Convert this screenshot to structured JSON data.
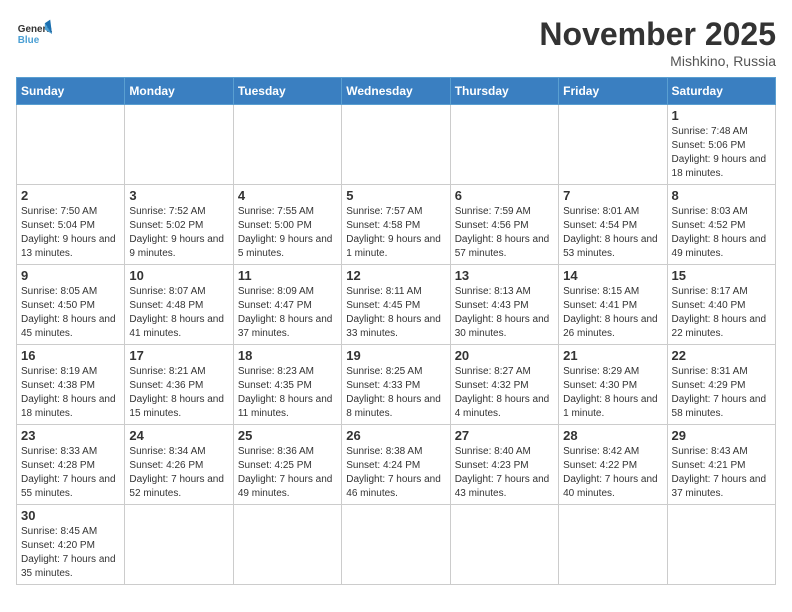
{
  "header": {
    "logo_general": "General",
    "logo_blue": "Blue",
    "month_title": "November 2025",
    "location": "Mishkino, Russia"
  },
  "weekdays": [
    "Sunday",
    "Monday",
    "Tuesday",
    "Wednesday",
    "Thursday",
    "Friday",
    "Saturday"
  ],
  "weeks": [
    [
      {
        "day": "",
        "info": ""
      },
      {
        "day": "",
        "info": ""
      },
      {
        "day": "",
        "info": ""
      },
      {
        "day": "",
        "info": ""
      },
      {
        "day": "",
        "info": ""
      },
      {
        "day": "",
        "info": ""
      },
      {
        "day": "1",
        "info": "Sunrise: 7:48 AM\nSunset: 5:06 PM\nDaylight: 9 hours and 18 minutes."
      }
    ],
    [
      {
        "day": "2",
        "info": "Sunrise: 7:50 AM\nSunset: 5:04 PM\nDaylight: 9 hours and 13 minutes."
      },
      {
        "day": "3",
        "info": "Sunrise: 7:52 AM\nSunset: 5:02 PM\nDaylight: 9 hours and 9 minutes."
      },
      {
        "day": "4",
        "info": "Sunrise: 7:55 AM\nSunset: 5:00 PM\nDaylight: 9 hours and 5 minutes."
      },
      {
        "day": "5",
        "info": "Sunrise: 7:57 AM\nSunset: 4:58 PM\nDaylight: 9 hours and 1 minute."
      },
      {
        "day": "6",
        "info": "Sunrise: 7:59 AM\nSunset: 4:56 PM\nDaylight: 8 hours and 57 minutes."
      },
      {
        "day": "7",
        "info": "Sunrise: 8:01 AM\nSunset: 4:54 PM\nDaylight: 8 hours and 53 minutes."
      },
      {
        "day": "8",
        "info": "Sunrise: 8:03 AM\nSunset: 4:52 PM\nDaylight: 8 hours and 49 minutes."
      }
    ],
    [
      {
        "day": "9",
        "info": "Sunrise: 8:05 AM\nSunset: 4:50 PM\nDaylight: 8 hours and 45 minutes."
      },
      {
        "day": "10",
        "info": "Sunrise: 8:07 AM\nSunset: 4:48 PM\nDaylight: 8 hours and 41 minutes."
      },
      {
        "day": "11",
        "info": "Sunrise: 8:09 AM\nSunset: 4:47 PM\nDaylight: 8 hours and 37 minutes."
      },
      {
        "day": "12",
        "info": "Sunrise: 8:11 AM\nSunset: 4:45 PM\nDaylight: 8 hours and 33 minutes."
      },
      {
        "day": "13",
        "info": "Sunrise: 8:13 AM\nSunset: 4:43 PM\nDaylight: 8 hours and 30 minutes."
      },
      {
        "day": "14",
        "info": "Sunrise: 8:15 AM\nSunset: 4:41 PM\nDaylight: 8 hours and 26 minutes."
      },
      {
        "day": "15",
        "info": "Sunrise: 8:17 AM\nSunset: 4:40 PM\nDaylight: 8 hours and 22 minutes."
      }
    ],
    [
      {
        "day": "16",
        "info": "Sunrise: 8:19 AM\nSunset: 4:38 PM\nDaylight: 8 hours and 18 minutes."
      },
      {
        "day": "17",
        "info": "Sunrise: 8:21 AM\nSunset: 4:36 PM\nDaylight: 8 hours and 15 minutes."
      },
      {
        "day": "18",
        "info": "Sunrise: 8:23 AM\nSunset: 4:35 PM\nDaylight: 8 hours and 11 minutes."
      },
      {
        "day": "19",
        "info": "Sunrise: 8:25 AM\nSunset: 4:33 PM\nDaylight: 8 hours and 8 minutes."
      },
      {
        "day": "20",
        "info": "Sunrise: 8:27 AM\nSunset: 4:32 PM\nDaylight: 8 hours and 4 minutes."
      },
      {
        "day": "21",
        "info": "Sunrise: 8:29 AM\nSunset: 4:30 PM\nDaylight: 8 hours and 1 minute."
      },
      {
        "day": "22",
        "info": "Sunrise: 8:31 AM\nSunset: 4:29 PM\nDaylight: 7 hours and 58 minutes."
      }
    ],
    [
      {
        "day": "23",
        "info": "Sunrise: 8:33 AM\nSunset: 4:28 PM\nDaylight: 7 hours and 55 minutes."
      },
      {
        "day": "24",
        "info": "Sunrise: 8:34 AM\nSunset: 4:26 PM\nDaylight: 7 hours and 52 minutes."
      },
      {
        "day": "25",
        "info": "Sunrise: 8:36 AM\nSunset: 4:25 PM\nDaylight: 7 hours and 49 minutes."
      },
      {
        "day": "26",
        "info": "Sunrise: 8:38 AM\nSunset: 4:24 PM\nDaylight: 7 hours and 46 minutes."
      },
      {
        "day": "27",
        "info": "Sunrise: 8:40 AM\nSunset: 4:23 PM\nDaylight: 7 hours and 43 minutes."
      },
      {
        "day": "28",
        "info": "Sunrise: 8:42 AM\nSunset: 4:22 PM\nDaylight: 7 hours and 40 minutes."
      },
      {
        "day": "29",
        "info": "Sunrise: 8:43 AM\nSunset: 4:21 PM\nDaylight: 7 hours and 37 minutes."
      }
    ],
    [
      {
        "day": "30",
        "info": "Sunrise: 8:45 AM\nSunset: 4:20 PM\nDaylight: 7 hours and 35 minutes."
      },
      {
        "day": "",
        "info": ""
      },
      {
        "day": "",
        "info": ""
      },
      {
        "day": "",
        "info": ""
      },
      {
        "day": "",
        "info": ""
      },
      {
        "day": "",
        "info": ""
      },
      {
        "day": "",
        "info": ""
      }
    ]
  ]
}
